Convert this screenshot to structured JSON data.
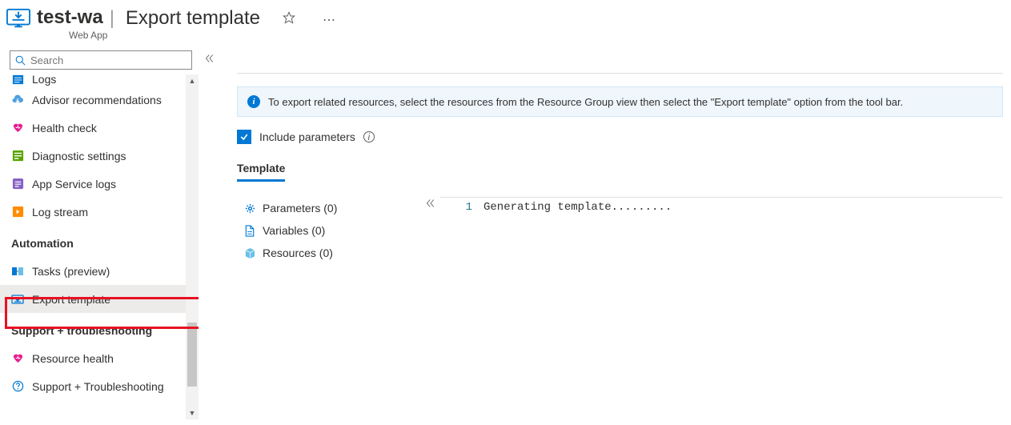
{
  "header": {
    "resource_name": "test-wa",
    "separator": "|",
    "page_title": "Export template",
    "resource_type": "Web App"
  },
  "sidebar": {
    "search_placeholder": "Search",
    "items": [
      {
        "label": "Logs",
        "icon": "logs-icon",
        "kind": "item",
        "icon_color": "#0078d4",
        "cut": true
      },
      {
        "label": "Advisor recommendations",
        "icon": "cloud-icon",
        "kind": "item",
        "icon_color": "#50a0e0"
      },
      {
        "label": "Health check",
        "icon": "heart-icon",
        "kind": "item",
        "icon_color": "#e61f8e"
      },
      {
        "label": "Diagnostic settings",
        "icon": "settings-icon",
        "kind": "item",
        "icon_color": "#57a300"
      },
      {
        "label": "App Service logs",
        "icon": "app-logs-icon",
        "kind": "item",
        "icon_color": "#8661c5"
      },
      {
        "label": "Log stream",
        "icon": "stream-icon",
        "kind": "item",
        "icon_color": "#ff8c00"
      },
      {
        "label": "Automation",
        "icon": "",
        "kind": "group"
      },
      {
        "label": "Tasks (preview)",
        "icon": "tasks-icon",
        "kind": "item",
        "icon_color": "#0078d4"
      },
      {
        "label": "Export template",
        "icon": "export-icon",
        "kind": "item",
        "icon_color": "#0078d4",
        "selected": true
      },
      {
        "label": "Support + troubleshooting",
        "icon": "",
        "kind": "group"
      },
      {
        "label": "Resource health",
        "icon": "heart-icon",
        "kind": "item",
        "icon_color": "#e61f8e"
      },
      {
        "label": "Support + Troubleshooting",
        "icon": "support-icon",
        "kind": "item",
        "icon_color": "#0078d4"
      }
    ]
  },
  "main": {
    "info_text": "To export related resources, select the resources from the Resource Group view then select the \"Export template\" option from the tool bar.",
    "include_parameters_label": "Include parameters",
    "include_parameters_checked": true,
    "tabs": [
      {
        "label": "Template",
        "active": true
      }
    ],
    "tree": [
      {
        "label": "Parameters (0)",
        "icon": "gear-icon",
        "color": "#0078d4"
      },
      {
        "label": "Variables (0)",
        "icon": "file-icon",
        "color": "#0078d4"
      },
      {
        "label": "Resources (0)",
        "icon": "cube-icon",
        "color": "#69c0e8"
      }
    ],
    "code": {
      "line_number": "1",
      "line_text": "Generating template........."
    }
  }
}
